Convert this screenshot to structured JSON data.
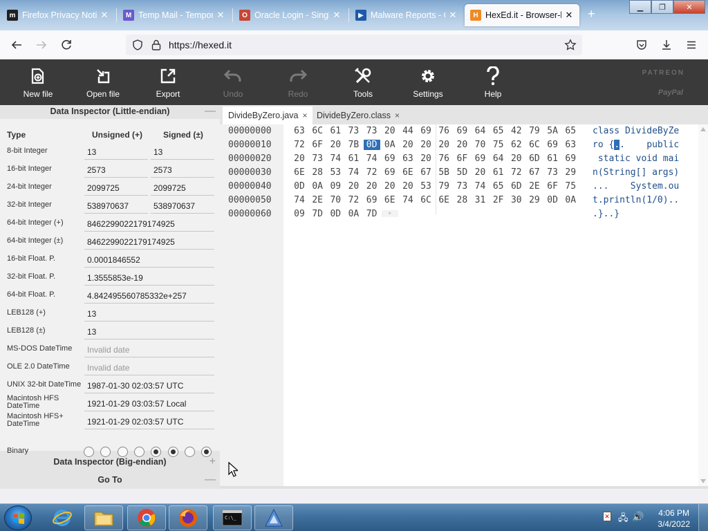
{
  "browser": {
    "tabs": [
      {
        "label": "Firefox Privacy Notic",
        "favicon": "m",
        "favicon_color": "#1f1f1f"
      },
      {
        "label": "Temp Mail - Tempor",
        "favicon": "M",
        "favicon_color": "#6a5acd"
      },
      {
        "label": "Oracle Login - Single",
        "favicon": "O",
        "favicon_color": "#c74634"
      },
      {
        "label": "Malware Reports - C",
        "favicon": "▶",
        "favicon_color": "#1e5aa8"
      },
      {
        "label": "HexEd.it - Browser-b",
        "favicon": "H",
        "favicon_color": "#f08a24",
        "active": true
      }
    ],
    "url": "https://hexed.it"
  },
  "toolbar": {
    "items": [
      {
        "label": "New file",
        "icon": "new-file-icon",
        "enabled": true
      },
      {
        "label": "Open file",
        "icon": "open-file-icon",
        "enabled": true
      },
      {
        "label": "Export",
        "icon": "export-icon",
        "enabled": true
      },
      {
        "label": "Undo",
        "icon": "undo-icon",
        "enabled": false
      },
      {
        "label": "Redo",
        "icon": "redo-icon",
        "enabled": false
      },
      {
        "label": "Tools",
        "icon": "tools-icon",
        "enabled": true
      },
      {
        "label": "Settings",
        "icon": "gear-icon",
        "enabled": true
      },
      {
        "label": "Help",
        "icon": "help-icon",
        "enabled": true
      }
    ],
    "sponsor_1": "PATREON",
    "sponsor_2": "PayPal"
  },
  "inspector": {
    "title": "Data Inspector (Little-endian)",
    "toggle": "—",
    "col_type": "Type",
    "col_unsigned": "Unsigned (+)",
    "col_signed": "Signed (±)",
    "rows": [
      {
        "type": "8-bit Integer",
        "unsigned": "13",
        "signed": "13"
      },
      {
        "type": "16-bit Integer",
        "unsigned": "2573",
        "signed": "2573"
      },
      {
        "type": "24-bit Integer",
        "unsigned": "2099725",
        "signed": "2099725"
      },
      {
        "type": "32-bit Integer",
        "unsigned": "538970637",
        "signed": "538970637"
      },
      {
        "type": "64-bit Integer (+)",
        "value": "8462299022179174925"
      },
      {
        "type": "64-bit Integer (±)",
        "value": "8462299022179174925"
      },
      {
        "type": "16-bit Float. P.",
        "value": "0.0001846552"
      },
      {
        "type": "32-bit Float. P.",
        "value": "1.3555853e-19"
      },
      {
        "type": "64-bit Float. P.",
        "value": "4.842495560785332e+257"
      },
      {
        "type": "LEB128 (+)",
        "value": "13"
      },
      {
        "type": "LEB128 (±)",
        "value": "13"
      },
      {
        "type": "MS-DOS DateTime",
        "value": "Invalid date",
        "muted": true
      },
      {
        "type": "OLE 2.0 DateTime",
        "value": "Invalid date",
        "muted": true
      },
      {
        "type": "UNIX 32-bit DateTime",
        "value": "1987-01-30 02:03:57 UTC"
      },
      {
        "type": "Macintosh HFS DateTime",
        "value": "1921-01-29 03:03:57 Local"
      },
      {
        "type": "Macintosh HFS+ DateTime",
        "value": "1921-01-29 02:03:57 UTC"
      }
    ],
    "binary_label": "Binary",
    "binary_bits": [
      0,
      0,
      0,
      0,
      1,
      1,
      0,
      1
    ],
    "big_endian_title": "Data Inspector (Big-endian)",
    "big_endian_toggle": "+",
    "goto_title": "Go To",
    "goto_toggle": "—"
  },
  "editor": {
    "tabs": [
      {
        "label": "DivideByZero.java",
        "close": "×",
        "active": true
      },
      {
        "label": "DivideByZero.class",
        "close": "×",
        "active": false
      }
    ],
    "rows": [
      {
        "offset": "00000000",
        "bytes": [
          "63",
          "6C",
          "61",
          "73",
          "73",
          "20",
          "44",
          "69",
          "76",
          "69",
          "64",
          "65",
          "42",
          "79",
          "5A",
          "65"
        ],
        "ascii": "class DivideByZe"
      },
      {
        "offset": "00000010",
        "bytes": [
          "72",
          "6F",
          "20",
          "7B",
          "0D",
          "0A",
          "20",
          "20",
          "20",
          "20",
          "70",
          "75",
          "62",
          "6C",
          "69",
          "63"
        ],
        "ascii": "ro {..    public"
      },
      {
        "offset": "00000020",
        "bytes": [
          "20",
          "73",
          "74",
          "61",
          "74",
          "69",
          "63",
          "20",
          "76",
          "6F",
          "69",
          "64",
          "20",
          "6D",
          "61",
          "69"
        ],
        "ascii": " static void mai"
      },
      {
        "offset": "00000030",
        "bytes": [
          "6E",
          "28",
          "53",
          "74",
          "72",
          "69",
          "6E",
          "67",
          "5B",
          "5D",
          "20",
          "61",
          "72",
          "67",
          "73",
          "29"
        ],
        "ascii": "n(String[] args)"
      },
      {
        "offset": "00000040",
        "bytes": [
          "0D",
          "0A",
          "09",
          "20",
          "20",
          "20",
          "20",
          "53",
          "79",
          "73",
          "74",
          "65",
          "6D",
          "2E",
          "6F",
          "75"
        ],
        "ascii": "...    System.ou"
      },
      {
        "offset": "00000050",
        "bytes": [
          "74",
          "2E",
          "70",
          "72",
          "69",
          "6E",
          "74",
          "6C",
          "6E",
          "28",
          "31",
          "2F",
          "30",
          "29",
          "0D",
          "0A"
        ],
        "ascii": "t.println(1/0).."
      },
      {
        "offset": "00000060",
        "bytes": [
          "09",
          "7D",
          "0D",
          "0A",
          "7D"
        ],
        "ascii": ".}..}"
      }
    ],
    "append_marker": "+",
    "selected": {
      "row": 1,
      "col": 4
    }
  },
  "taskbar": {
    "time": "4:06 PM",
    "date": "3/4/2022"
  }
}
